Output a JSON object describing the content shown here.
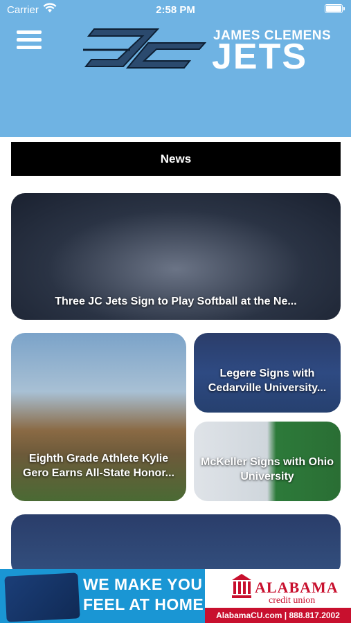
{
  "status": {
    "carrier": "Carrier",
    "time": "2:58 PM"
  },
  "header": {
    "school_name": "JAMES CLEMENS",
    "team_name": "JETS"
  },
  "nav": {
    "news_label": "News"
  },
  "articles": [
    {
      "title": "Three JC Jets Sign to Play Softball at the Ne..."
    },
    {
      "title": "Eighth Grade Athlete Kylie Gero Earns All-State Honor..."
    },
    {
      "title": "Legere Signs with Cedarville University..."
    },
    {
      "title": "McKeller Signs with Ohio University"
    },
    {
      "title": ""
    }
  ],
  "ad": {
    "headline_1": "WE MAKE YOU",
    "headline_2": "FEEL AT HOME!",
    "brand": "ALABAMA",
    "brand_sub": "credit union",
    "footer": "AlabamaCU.com  |  888.817.2002"
  },
  "colors": {
    "header_bg": "#6fb3e3",
    "news_bar_bg": "#000000",
    "ad_bg": "#1a96d4",
    "brand_red": "#c8102e"
  }
}
